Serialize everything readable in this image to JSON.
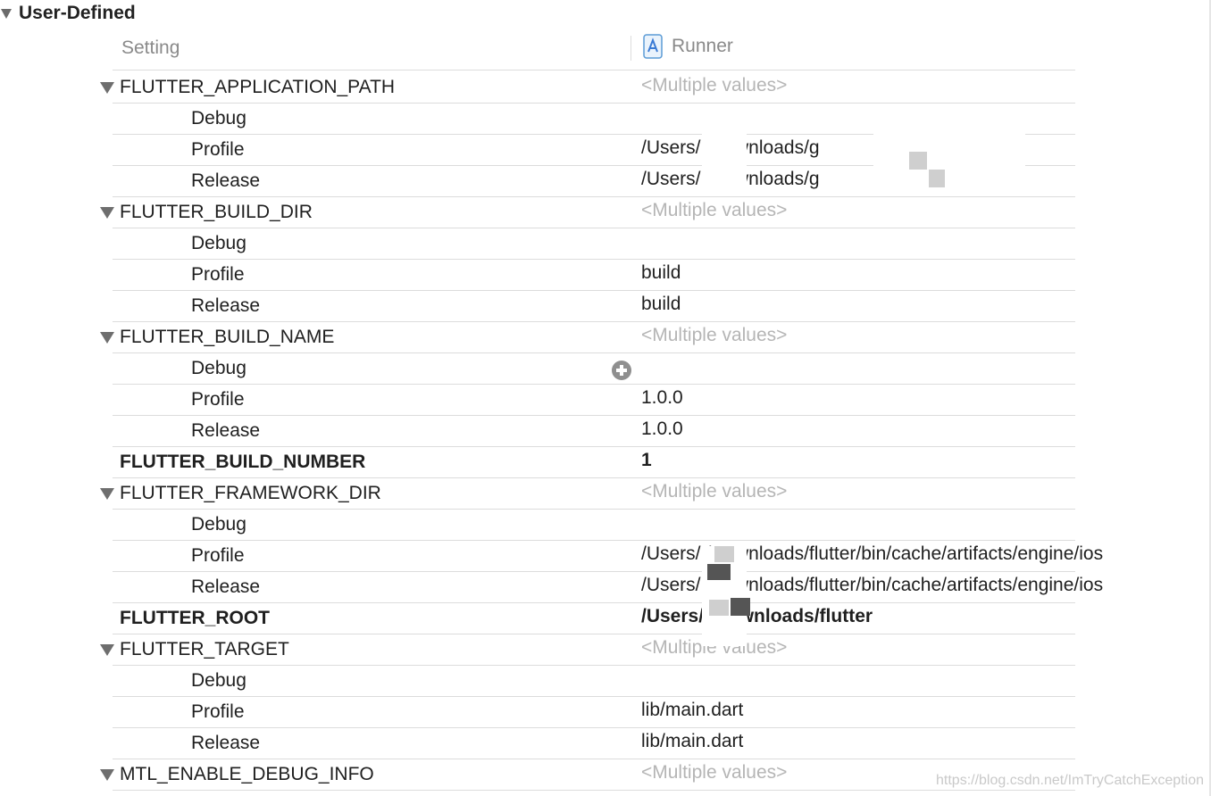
{
  "section": {
    "title": "User-Defined"
  },
  "columns": {
    "setting": "Setting",
    "target": "Runner"
  },
  "rows": [
    {
      "kind": "group",
      "name": "FLUTTER_APPLICATION_PATH",
      "value": "<Multiple values>"
    },
    {
      "kind": "sub",
      "name": "Debug",
      "value": ""
    },
    {
      "kind": "sub",
      "name": "Profile",
      "value": "/Users/   /Downloads/g"
    },
    {
      "kind": "sub",
      "name": "Release",
      "value": "/Users/   /Downloads/g"
    },
    {
      "kind": "group",
      "name": "FLUTTER_BUILD_DIR",
      "value": "<Multiple values>"
    },
    {
      "kind": "sub",
      "name": "Debug",
      "value": ""
    },
    {
      "kind": "sub",
      "name": "Profile",
      "value": "build"
    },
    {
      "kind": "sub",
      "name": "Release",
      "value": "build"
    },
    {
      "kind": "group",
      "name": "FLUTTER_BUILD_NAME",
      "value": "<Multiple values>"
    },
    {
      "kind": "sub",
      "name": "Debug",
      "value": "",
      "add_button": true
    },
    {
      "kind": "sub",
      "name": "Profile",
      "value": "1.0.0"
    },
    {
      "kind": "sub",
      "name": "Release",
      "value": "1.0.0"
    },
    {
      "kind": "single",
      "name": "FLUTTER_BUILD_NUMBER",
      "value": "1"
    },
    {
      "kind": "group",
      "name": "FLUTTER_FRAMEWORK_DIR",
      "value": "<Multiple values>"
    },
    {
      "kind": "sub",
      "name": "Debug",
      "value": ""
    },
    {
      "kind": "sub",
      "name": "Profile",
      "value": "/Users/   /Downloads/flutter/bin/cache/artifacts/engine/ios"
    },
    {
      "kind": "sub",
      "name": "Release",
      "value": "/Users/   /Downloads/flutter/bin/cache/artifacts/engine/ios"
    },
    {
      "kind": "single",
      "name": "FLUTTER_ROOT",
      "value": "/Users/   /Downloads/flutter"
    },
    {
      "kind": "group",
      "name": "FLUTTER_TARGET",
      "value": "<Multiple values>"
    },
    {
      "kind": "sub",
      "name": "Debug",
      "value": ""
    },
    {
      "kind": "sub",
      "name": "Profile",
      "value": "lib/main.dart"
    },
    {
      "kind": "sub",
      "name": "Release",
      "value": "lib/main.dart"
    },
    {
      "kind": "group",
      "name": "MTL_ENABLE_DEBUG_INFO",
      "value": "<Multiple values>"
    }
  ],
  "watermark": "https://blog.csdn.net/ImTryCatchException"
}
